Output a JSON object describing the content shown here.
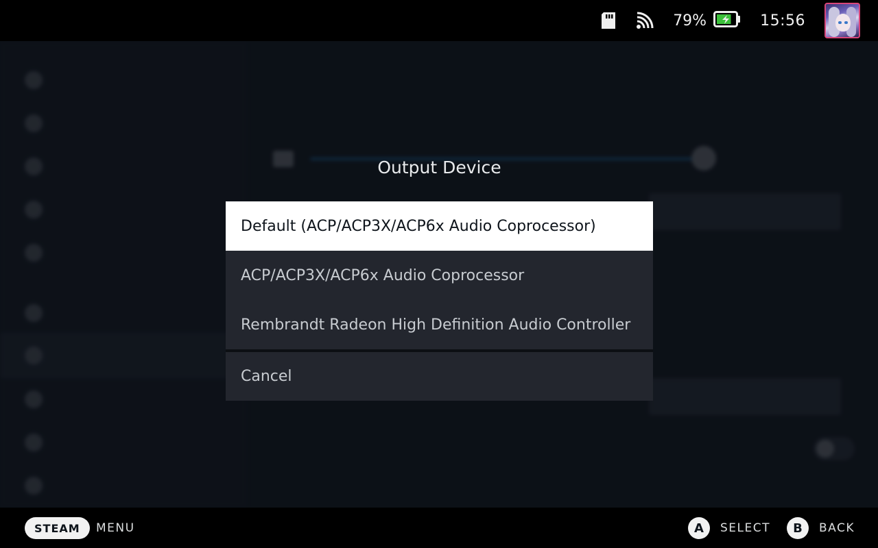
{
  "status_bar": {
    "battery_percent": "79%",
    "battery_level": 0.79,
    "time": "15:56",
    "icons": [
      "sd-card-icon",
      "wifi-icon",
      "battery-charging-icon"
    ]
  },
  "dialog": {
    "title": "Output Device",
    "options": [
      {
        "label": "Default (ACP/ACP3X/ACP6x Audio Coprocessor)",
        "selected": true
      },
      {
        "label": "ACP/ACP3X/ACP6x Audio Coprocessor",
        "selected": false
      },
      {
        "label": "Rembrandt Radeon High Definition Audio Controller",
        "selected": false
      }
    ],
    "cancel_label": "Cancel"
  },
  "bottom_bar": {
    "steam_label": "STEAM",
    "menu_label": "MENU",
    "a_glyph": "A",
    "select_label": "SELECT",
    "b_glyph": "B",
    "back_label": "BACK"
  },
  "colors": {
    "accent": "#1a9fff",
    "selected_bg": "#ffffff",
    "option_bg": "#23262e",
    "bar_bg": "#000000",
    "avatar_border": "#d9467a",
    "battery_fill": "#3cc13b"
  }
}
